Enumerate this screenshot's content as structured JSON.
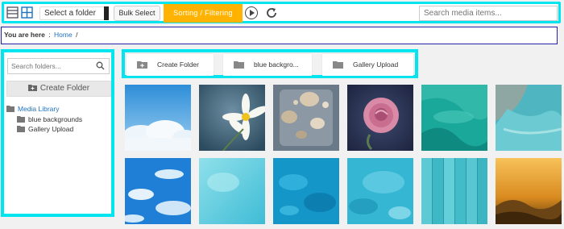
{
  "toolbar": {
    "list_view_icon": "list-view-icon",
    "grid_view_icon": "grid-view-icon",
    "select_folder_label": "Select a folder",
    "bulk_select_label": "Bulk Select",
    "sorting_label": "Sorting / Filtering",
    "search_placeholder": "Search media items..."
  },
  "breadcrumb": {
    "prefix": "You are here",
    "separator": ":",
    "home": "Home",
    "trail_separator": "/"
  },
  "sidebar": {
    "search_placeholder": "Search folders...",
    "create_folder_label": "Create Folder",
    "tree": {
      "root": "Media Library",
      "children": [
        "blue backgrounds",
        "Gallery Upload"
      ]
    }
  },
  "folder_cards": [
    {
      "label": "Create Folder",
      "icon": "add-folder-icon"
    },
    {
      "label": "blue backgro...",
      "icon": "folder-icon"
    },
    {
      "label": "Gallery Upload",
      "icon": "folder-icon"
    }
  ],
  "colors": {
    "highlight": "#00e5f0",
    "accent": "#ffb300",
    "link": "#1e73be",
    "breadcrumb_border": "#2222aa"
  },
  "media_items": [
    {
      "subject": "clouds over blue sky"
    },
    {
      "subject": "white daffodil flower"
    },
    {
      "subject": "seashells on sand"
    },
    {
      "subject": "pink rose"
    },
    {
      "subject": "turquoise sea from above"
    },
    {
      "subject": "turquoise water and shore"
    },
    {
      "subject": "blue sky with clouds"
    },
    {
      "subject": "light aqua texture"
    },
    {
      "subject": "blue water texture"
    },
    {
      "subject": "turquoise watercolor texture"
    },
    {
      "subject": "turquoise wooden planks"
    },
    {
      "subject": "misty golden forest"
    }
  ]
}
